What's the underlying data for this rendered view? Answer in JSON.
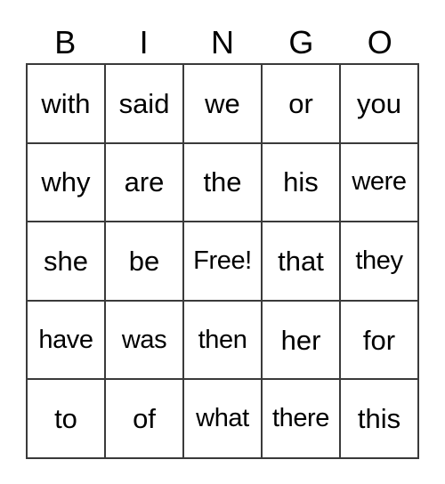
{
  "card": {
    "title": "BINGO",
    "header_letters": [
      "B",
      "I",
      "N",
      "G",
      "O"
    ],
    "free_space_label": "Free!",
    "colors": {
      "border": "#3a3a3a",
      "text": "#000000",
      "background": "#ffffff"
    },
    "rows": [
      {
        "cells": [
          "with",
          "said",
          "we",
          "or",
          "you"
        ]
      },
      {
        "cells": [
          "why",
          "are",
          "the",
          "his",
          "were"
        ]
      },
      {
        "cells": [
          "she",
          "be",
          "Free!",
          "that",
          "they"
        ]
      },
      {
        "cells": [
          "have",
          "was",
          "then",
          "her",
          "for"
        ]
      },
      {
        "cells": [
          "to",
          "of",
          "what",
          "there",
          "this"
        ]
      }
    ]
  }
}
